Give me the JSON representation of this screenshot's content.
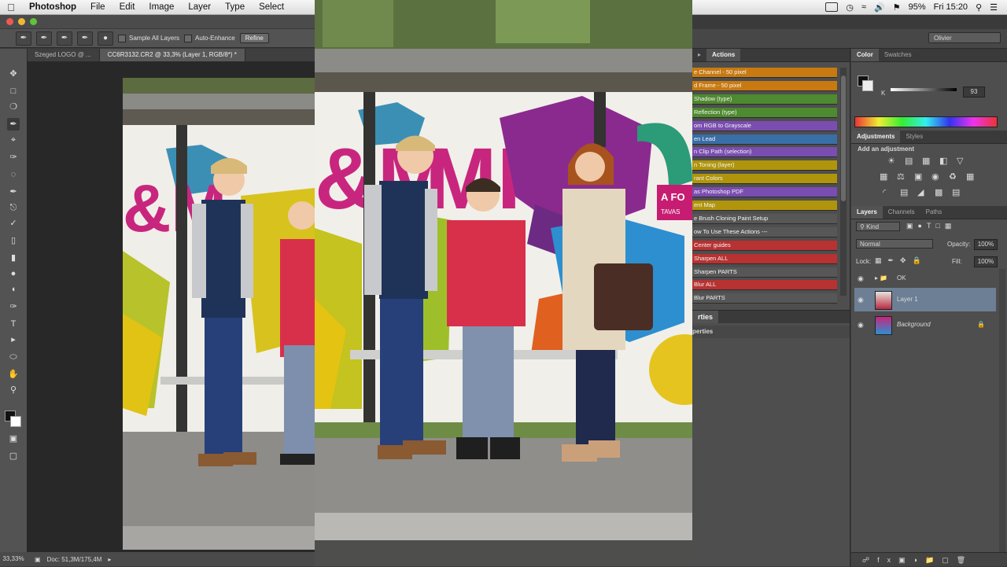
{
  "menubar": {
    "items": [
      "Photoshop",
      "File",
      "Edit",
      "Image",
      "Layer",
      "Type",
      "Select"
    ],
    "battery": "95%",
    "clock": "Fri 15:20"
  },
  "options_bar": {
    "sample_all_layers": "Sample All Layers",
    "auto_enhance": "Auto-Enhance",
    "refine": "Refine"
  },
  "doc_tabs": [
    {
      "label": "Szeged LOGO @ ..."
    },
    {
      "label": "CC6R3132.CR2 @ 33,3% (Layer 1, RGB/8*) *"
    }
  ],
  "status": {
    "zoom": "33,33%",
    "doc": "Doc: 51,3M/175,4M"
  },
  "workspace": "Olivier",
  "actions_panel": {
    "tabs": [
      "Actions"
    ],
    "items": [
      {
        "label": "e Channel - 50 pixel",
        "color": "#c87a10"
      },
      {
        "label": "d Frame - 50 pixel",
        "color": "#c87a10"
      },
      {
        "label": "Shadow (type)",
        "color": "#4e8a2f"
      },
      {
        "label": "Reflection (type)",
        "color": "#4e8a2f"
      },
      {
        "label": "om RGB to Grayscale",
        "color": "#7a4db0"
      },
      {
        "label": "en Lead",
        "color": "#3a6ea6"
      },
      {
        "label": "n Clip Path (selection)",
        "color": "#7a4db0"
      },
      {
        "label": "n Toning (layer)",
        "color": "#b0950c"
      },
      {
        "label": "rant Colors",
        "color": "#b0950c"
      },
      {
        "label": "as Photoshop PDF",
        "color": "#7a4db0"
      },
      {
        "label": "ent Map",
        "color": "#b0950c"
      },
      {
        "label": "e Brush Cloning Paint Setup",
        "color": "#575757"
      },
      {
        "label": "ow To Use These Actions ---",
        "color": "#575757"
      },
      {
        "label": "Center guides",
        "color": "#b83232"
      },
      {
        "label": "Sharpen ALL",
        "color": "#b83232"
      },
      {
        "label": "Sharpen PARTS",
        "color": "#575757"
      },
      {
        "label": "Blur ALL",
        "color": "#b83232"
      },
      {
        "label": "Blur PARTS",
        "color": "#575757"
      }
    ]
  },
  "properties_panel": {
    "tab": "rties",
    "title": "perties"
  },
  "color_panel": {
    "tabs": [
      "Color",
      "Swatches"
    ],
    "channel": "K",
    "value": "93"
  },
  "adjustments_panel": {
    "tabs": [
      "Adjustments",
      "Styles"
    ],
    "heading": "Add an adjustment"
  },
  "layers_panel": {
    "tabs": [
      "Layers",
      "Channels",
      "Paths"
    ],
    "filter": "Kind",
    "blend_mode": "Normal",
    "opacity_label": "Opacity:",
    "opacity": "100%",
    "lock_label": "Lock:",
    "fill_label": "Fill:",
    "fill": "100%",
    "layers": [
      {
        "name": "OK",
        "type": "group"
      },
      {
        "name": "Layer 1",
        "type": "pixel",
        "selected": true
      },
      {
        "name": "Background",
        "type": "background"
      }
    ]
  }
}
